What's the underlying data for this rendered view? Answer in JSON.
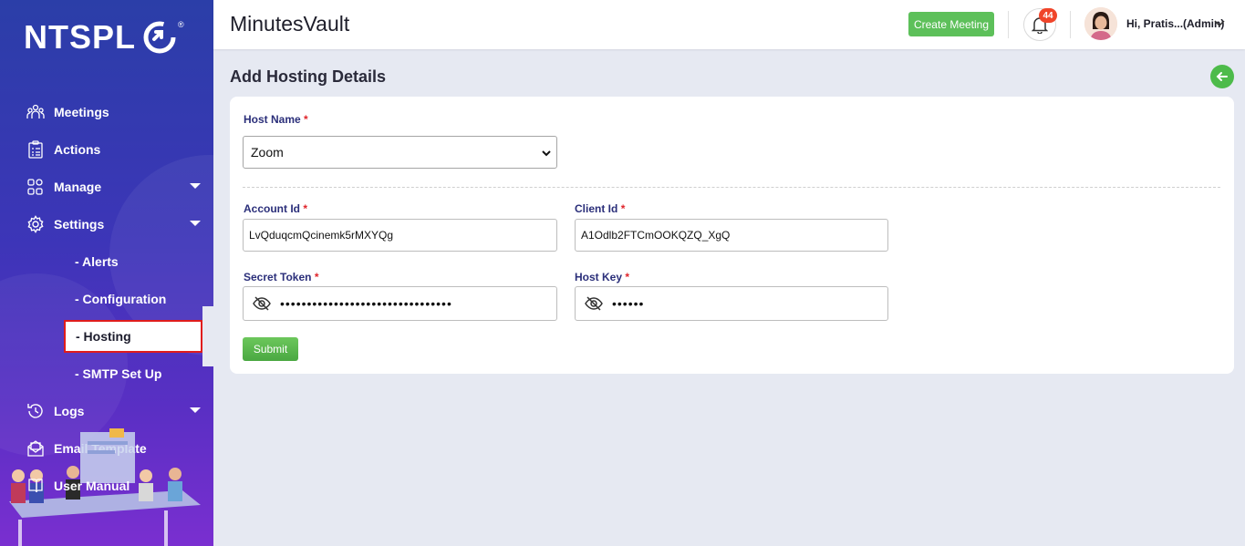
{
  "app": {
    "brand": "NTSPL",
    "title": "MinutesVault"
  },
  "sidebar": {
    "items": [
      {
        "label": "Meetings",
        "icon": "meetings-icon"
      },
      {
        "label": "Actions",
        "icon": "clipboard-icon"
      },
      {
        "label": "Manage",
        "icon": "grid-icon",
        "expandable": true
      },
      {
        "label": "Settings",
        "icon": "gear-icon",
        "expandable": true
      }
    ],
    "settings_sub": [
      "- Alerts",
      "- Configuration",
      "- Hosting",
      "- SMTP Set Up"
    ],
    "active_sub": "- Hosting",
    "bottom_items": [
      {
        "label": "Logs",
        "icon": "history-icon",
        "expandable": true
      },
      {
        "label": "Email Template",
        "icon": "email-icon"
      },
      {
        "label": "User Manual",
        "icon": "book-icon"
      }
    ]
  },
  "header": {
    "create_label": "Create Meeting",
    "notification_count": "44",
    "user_label": "Hi, Pratis...(Admin)"
  },
  "page": {
    "title": "Add Hosting Details"
  },
  "form": {
    "host_name": {
      "label": "Host Name",
      "value": "Zoom"
    },
    "account_id": {
      "label": "Account Id",
      "value": "LvQduqcmQcinemk5rMXYQg"
    },
    "client_id": {
      "label": "Client Id",
      "value": "A1Odlb2FTCmOOKQZQ_XgQ"
    },
    "secret_token": {
      "label": "Secret Token",
      "value": "••••••••••••••••••••••••••••••••"
    },
    "host_key": {
      "label": "Host Key",
      "value": "••••••"
    },
    "required_mark": "*",
    "submit_label": "Submit"
  },
  "colors": {
    "accent_green": "#5dc05a",
    "label_blue": "#2b2f7a",
    "required_red": "#e0242a",
    "sidebar_top": "#2b3ea8",
    "sidebar_bottom": "#7a2fd0"
  }
}
